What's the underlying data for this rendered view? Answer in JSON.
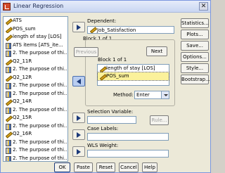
{
  "window": {
    "title": "Linear Regression",
    "close_glyph": "✕"
  },
  "variables": [
    {
      "label": "ATS",
      "icon": "pencil-icon"
    },
    {
      "label": "POS_sum",
      "icon": "pencil-icon"
    },
    {
      "label": "length of stay [LOS]",
      "icon": "pencil-icon"
    },
    {
      "label": "ATS items [ATS_ite...",
      "icon": "scale-icon"
    },
    {
      "label": "2. The purpose of thi...",
      "icon": "scale-icon"
    },
    {
      "label": "Q2_11R",
      "icon": "pencil-icon"
    },
    {
      "label": "2. The purpose of thi...",
      "icon": "scale-icon"
    },
    {
      "label": "Q2_12R",
      "icon": "pencil-icon"
    },
    {
      "label": "2. The purpose of thi...",
      "icon": "scale-icon"
    },
    {
      "label": "2. The purpose of thi...",
      "icon": "scale-icon"
    },
    {
      "label": "Q2_14R",
      "icon": "pencil-icon"
    },
    {
      "label": "2. The purpose of thi...",
      "icon": "scale-icon"
    },
    {
      "label": "Q2_15R",
      "icon": "pencil-icon"
    },
    {
      "label": "2. The purpose of thi...",
      "icon": "scale-icon"
    },
    {
      "label": "Q2_16R",
      "icon": "pencil-icon"
    },
    {
      "label": "2. The purpose of thi...",
      "icon": "scale-icon"
    },
    {
      "label": "2. The purpose of thi...",
      "icon": "scale-icon"
    },
    {
      "label": "2. The purpose of thi...",
      "icon": "scale-icon"
    }
  ],
  "dependent": {
    "label": "Dependent:",
    "value": "Job_Satisfaction"
  },
  "block": {
    "header": "Block 1 of 1",
    "previous_label": "Previous",
    "next_label": "Next",
    "inner_label": "Block 1 of 1",
    "independents": [
      {
        "label": "length of stay [LOS]",
        "selected": false
      },
      {
        "label": "POS_sum",
        "selected": true
      }
    ],
    "method_label": "Method:",
    "method_value": "Enter"
  },
  "selection_variable": {
    "label": "Selection Variable:",
    "rule_label": "Rule..."
  },
  "case_labels": {
    "label": "Case Labels:"
  },
  "wls_weight": {
    "label": "WLS Weight:"
  },
  "side_buttons": [
    "Statistics...",
    "Plots...",
    "Save...",
    "Options...",
    "Style...",
    "Bootstrap..."
  ],
  "bottom_buttons": [
    "OK",
    "Paste",
    "Reset",
    "Cancel",
    "Help"
  ],
  "colors": {
    "selection_highlight": "#fbf19b",
    "dialog_bg": "#ece9d8"
  }
}
